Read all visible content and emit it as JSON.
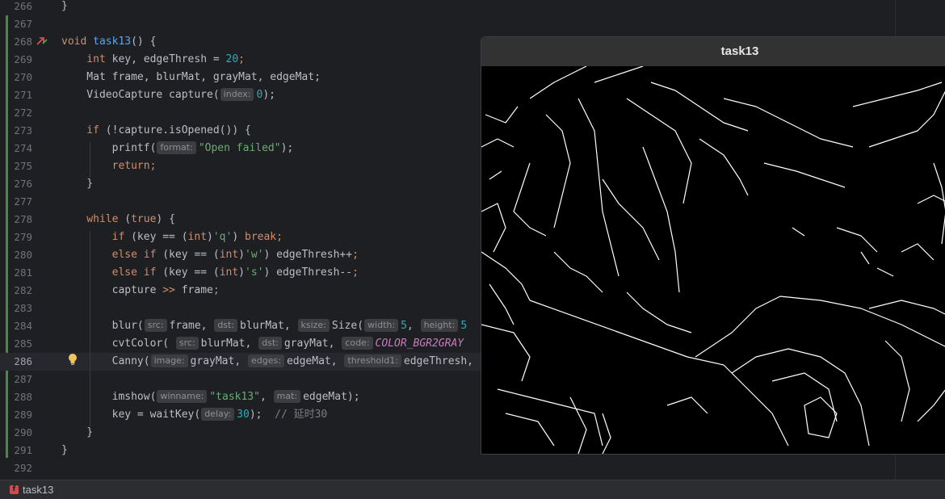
{
  "editor": {
    "lines": [
      {
        "no": "266",
        "segs": [
          {
            "t": "}",
            "c": "op"
          }
        ]
      },
      {
        "no": "267",
        "segs": []
      },
      {
        "no": "268",
        "segs": [
          {
            "t": "void ",
            "c": "kw"
          },
          {
            "t": "task13",
            "c": "fn"
          },
          {
            "t": "() {",
            "c": "op"
          }
        ]
      },
      {
        "no": "269",
        "segs": [
          {
            "t": "    int ",
            "c": "kw"
          },
          {
            "t": "key, edgeThresh = ",
            "c": "op"
          },
          {
            "t": "20",
            "c": "num"
          },
          {
            "t": ";",
            "c": "kw"
          }
        ]
      },
      {
        "no": "270",
        "segs": [
          {
            "t": "    Mat frame, blurMat, grayMat, edgeMat;",
            "c": "op"
          }
        ]
      },
      {
        "no": "271",
        "segs": [
          {
            "t": "    VideoCapture capture(",
            "c": "op"
          },
          {
            "h": "index:"
          },
          {
            "t": "0",
            "c": "num"
          },
          {
            "t": ");",
            "c": "op"
          }
        ]
      },
      {
        "no": "272",
        "segs": []
      },
      {
        "no": "273",
        "segs": [
          {
            "t": "    if ",
            "c": "kw"
          },
          {
            "t": "(!capture.isOpened()) {",
            "c": "op"
          }
        ]
      },
      {
        "no": "274",
        "segs": [
          {
            "t": "        printf(",
            "c": "op"
          },
          {
            "h": "format:"
          },
          {
            "t": "\"Open failed\"",
            "c": "str"
          },
          {
            "t": ");",
            "c": "op"
          }
        ]
      },
      {
        "no": "275",
        "segs": [
          {
            "t": "        return;",
            "c": "kw"
          }
        ]
      },
      {
        "no": "276",
        "segs": [
          {
            "t": "    }",
            "c": "op"
          }
        ]
      },
      {
        "no": "277",
        "segs": []
      },
      {
        "no": "278",
        "segs": [
          {
            "t": "    while ",
            "c": "kw"
          },
          {
            "t": "(",
            "c": "op"
          },
          {
            "t": "true",
            "c": "kw"
          },
          {
            "t": ") {",
            "c": "op"
          }
        ]
      },
      {
        "no": "279",
        "segs": [
          {
            "t": "        if ",
            "c": "kw"
          },
          {
            "t": "(key == (",
            "c": "op"
          },
          {
            "t": "int",
            "c": "kw"
          },
          {
            "t": ")",
            "c": "op"
          },
          {
            "t": "'q'",
            "c": "str"
          },
          {
            "t": ") ",
            "c": "op"
          },
          {
            "t": "break;",
            "c": "kw"
          }
        ]
      },
      {
        "no": "280",
        "segs": [
          {
            "t": "        else if ",
            "c": "kw"
          },
          {
            "t": "(key == (",
            "c": "op"
          },
          {
            "t": "int",
            "c": "kw"
          },
          {
            "t": ")",
            "c": "op"
          },
          {
            "t": "'w'",
            "c": "str"
          },
          {
            "t": ") edgeThresh++",
            "c": "op"
          },
          {
            "t": ";",
            "c": "kw"
          }
        ]
      },
      {
        "no": "281",
        "segs": [
          {
            "t": "        else if ",
            "c": "kw"
          },
          {
            "t": "(key == (",
            "c": "op"
          },
          {
            "t": "int",
            "c": "kw"
          },
          {
            "t": ")",
            "c": "op"
          },
          {
            "t": "'s'",
            "c": "str"
          },
          {
            "t": ") edgeThresh--",
            "c": "op"
          },
          {
            "t": ";",
            "c": "kw"
          }
        ]
      },
      {
        "no": "282",
        "segs": [
          {
            "t": "        capture ",
            "c": "op"
          },
          {
            "t": ">>",
            "c": "kw"
          },
          {
            "t": " frame",
            "c": "op"
          },
          {
            "t": ";",
            "c": "kw"
          }
        ]
      },
      {
        "no": "283",
        "segs": []
      },
      {
        "no": "284",
        "segs": [
          {
            "t": "        blur(",
            "c": "op"
          },
          {
            "h": "src:"
          },
          {
            "t": "frame, ",
            "c": "op"
          },
          {
            "h": "dst:"
          },
          {
            "t": "blurMat, ",
            "c": "op"
          },
          {
            "h": "ksize:"
          },
          {
            "t": "Size(",
            "c": "op"
          },
          {
            "h": "width:"
          },
          {
            "t": "5",
            "c": "num"
          },
          {
            "t": ", ",
            "c": "op"
          },
          {
            "h": "height:"
          },
          {
            "t": "5",
            "c": "num"
          }
        ]
      },
      {
        "no": "285",
        "segs": [
          {
            "t": "        cvtColor( ",
            "c": "op"
          },
          {
            "h": "src:"
          },
          {
            "t": "blurMat, ",
            "c": "op"
          },
          {
            "h": "dst:"
          },
          {
            "t": "grayMat, ",
            "c": "op"
          },
          {
            "h": "code:"
          },
          {
            "t": "COLOR_BGR2GRAY",
            "c": "cst"
          }
        ]
      },
      {
        "no": "286",
        "segs": [
          {
            "t": "        Canny(",
            "c": "op"
          },
          {
            "h": "image:"
          },
          {
            "t": "grayMat, ",
            "c": "op"
          },
          {
            "h": "edges:"
          },
          {
            "t": "edgeMat, ",
            "c": "op"
          },
          {
            "h": "threshold1:"
          },
          {
            "t": "edgeThresh,",
            "c": "op"
          }
        ],
        "current": true
      },
      {
        "no": "287",
        "segs": []
      },
      {
        "no": "288",
        "segs": [
          {
            "t": "        imshow(",
            "c": "op"
          },
          {
            "h": "winname:"
          },
          {
            "t": "\"task13\"",
            "c": "str"
          },
          {
            "t": ", ",
            "c": "op"
          },
          {
            "h": "mat:"
          },
          {
            "t": "edgeMat);",
            "c": "op"
          }
        ]
      },
      {
        "no": "289",
        "segs": [
          {
            "t": "        key = waitKey(",
            "c": "op"
          },
          {
            "h": "delay:"
          },
          {
            "t": "30",
            "c": "num"
          },
          {
            "t": ");  ",
            "c": "op"
          },
          {
            "t": "// 延时30",
            "c": "cmt"
          }
        ]
      },
      {
        "no": "290",
        "segs": [
          {
            "t": "    }",
            "c": "op"
          }
        ]
      },
      {
        "no": "291",
        "segs": [
          {
            "t": "}",
            "c": "op"
          }
        ]
      },
      {
        "no": "292",
        "segs": []
      }
    ]
  },
  "window": {
    "title": "task13"
  },
  "statusbar": {
    "label": "task13",
    "icon": "function-icon",
    "icon_glyph": "f"
  },
  "colors": {
    "vcs_bar": "#4b8b3f",
    "keyword": "#cf8e6d",
    "function": "#56a8f5",
    "number": "#2aacb8",
    "string": "#6aab73"
  }
}
